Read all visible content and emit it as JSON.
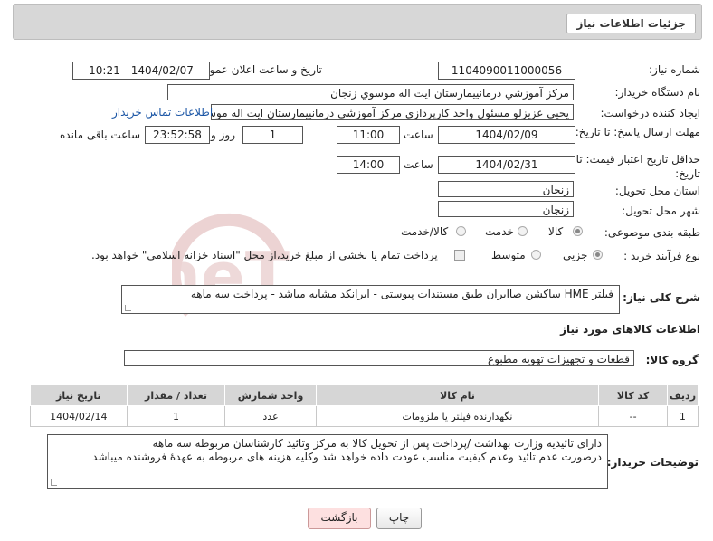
{
  "header": {
    "title": "جزئیات اطلاعات نیاز"
  },
  "form": {
    "need_number": {
      "label": "شماره نیاز:",
      "value": "1104090011000056"
    },
    "announce": {
      "label": "تاریخ و ساعت اعلان عمومی:",
      "value": "1404/02/07 - 10:21"
    },
    "buyer_org": {
      "label": "نام دستگاه خریدار:",
      "value": "مرکز آموزشي درمانييمارستان ايت اله موسوي زنجان"
    },
    "requester": {
      "label": "ایجاد کننده درخواست:",
      "value": "يحيي عزيزلو مسئول واحد کارپردازي مرکز آموزشي درمانييمارستان ايت اله موسو",
      "contact_link": "اطلاعات تماس خریدار"
    },
    "reply_deadline": {
      "label": "مهلت ارسال پاسخ: تا تاریخ:",
      "date": "1404/02/09",
      "time_label": "ساعت",
      "time": "11:00",
      "days": "1",
      "days_label": "روز و",
      "remaining": "23:52:58",
      "remaining_label": "ساعت باقی مانده"
    },
    "price_validity": {
      "label": "حداقل تاریخ اعتبار قیمت: تا تاریخ:",
      "date": "1404/02/31",
      "time_label": "ساعت",
      "time": "14:00"
    },
    "province": {
      "label": "استان محل تحویل:",
      "value": "زنجان"
    },
    "city": {
      "label": "شهر محل تحویل:",
      "value": "زنجان"
    },
    "category": {
      "label": "طبقه بندی موضوعی:",
      "options": [
        "کالا",
        "خدمت",
        "کالا/خدمت"
      ],
      "selected": "کالا"
    },
    "process": {
      "label": "نوع فرآیند خرید :",
      "options": [
        "جزیی",
        "متوسط"
      ],
      "selected": "جزیی",
      "note": "پرداخت تمام یا بخشی از مبلغ خرید،از محل \"اسناد خزانه اسلامی\" خواهد بود."
    },
    "description": {
      "label": "شرح کلی نیاز:",
      "value": "فیلتر HME ساکشن صاایران   طبق مستندات پیوستی - ایرانکد مشابه مباشد - پرداخت سه ماهه"
    }
  },
  "goods": {
    "section_title": "اطلاعات کالاهای مورد نیاز",
    "group_label": "گروه کالا:",
    "group_value": "قطعات و تجهیزات تهویه مطبوع",
    "columns": [
      "ردیف",
      "کد کالا",
      "نام کالا",
      "واحد شمارش",
      "تعداد / مقدار",
      "تاریخ نیاز"
    ],
    "rows": [
      {
        "row": "1",
        "code": "--",
        "name": "نگهدارنده فیلتر یا ملزومات",
        "unit": "عدد",
        "qty": "1",
        "date": "1404/02/14"
      }
    ]
  },
  "buyer_notes": {
    "label": "توضیحات خریدار:",
    "line1": "دارای تائیدیه وزارت بهداشت /پرداخت پس از تحویل کالا به مرکز وتائید کارشناسان مربوطه سه ماهه",
    "line2": "درصورت عدم تائید وعدم کیفیت مناسب عودت داده خواهد شد وکلیه هزینه های مربوطه به عهدهٔ فروشنده میباشد"
  },
  "buttons": {
    "print": "چاپ",
    "back": "بازگشت"
  },
  "watermark": {
    "text": "AriaTender.neT"
  },
  "colors": {
    "link": "#1a55a5",
    "back_button_bg": "#fde0e0",
    "watermark": "#e8c8c8"
  }
}
